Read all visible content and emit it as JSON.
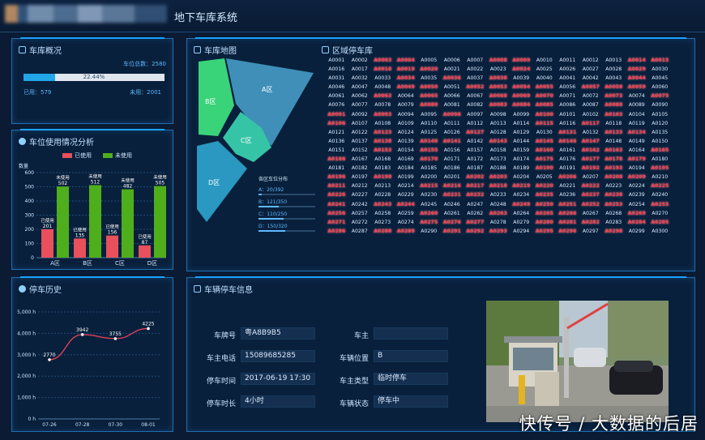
{
  "app": {
    "title": "地下车库系统"
  },
  "overview": {
    "title": "车库概况",
    "total_label": "车位总数：2580",
    "progress": 0.2244,
    "progress_label": "22.44%",
    "used_label": "已用：579",
    "free_label": "未用：2001"
  },
  "usage": {
    "title": "车位使用情况分析",
    "legend_used": "已使用",
    "legend_free": "未使用",
    "colors": {
      "used": "#e8505b",
      "free": "#4fae1c"
    }
  },
  "chart_data": [
    {
      "type": "bar",
      "ylabel": "数量",
      "ylim": [
        0,
        600
      ],
      "yticks": [
        "0",
        "100",
        "200",
        "300",
        "400",
        "500",
        "600"
      ],
      "categories": [
        "A区",
        "B区",
        "C区",
        "D区"
      ],
      "series": [
        {
          "name": "已使用",
          "values": [
            201,
            135,
            156,
            87
          ],
          "labels": [
            "已使用",
            "已使用",
            "已使用",
            "已使用"
          ]
        },
        {
          "name": "未使用",
          "values": [
            502,
            512,
            482,
            505
          ],
          "labels": [
            "未使用",
            "未使用",
            "未使用",
            "未使用"
          ]
        }
      ]
    },
    {
      "type": "line",
      "x": [
        "07-26",
        "07-28",
        "07-30",
        "08-01"
      ],
      "values": [
        2770,
        3942,
        3755,
        4225
      ],
      "ylim": [
        0,
        5000
      ],
      "yticks": [
        "0 h",
        "1,000 h",
        "2,000 h",
        "3,000 h",
        "4,000 h",
        "5,000 h"
      ]
    }
  ],
  "map": {
    "title": "车库地图",
    "zones": {
      "a": "A区",
      "b": "B区",
      "c": "C区",
      "d": "D区"
    },
    "legend_title": "各区车位分布",
    "legend": [
      {
        "label": "A：20/392",
        "ratio": 0.05
      },
      {
        "label": "B：121/350",
        "ratio": 0.35
      },
      {
        "label": "C：110/250",
        "ratio": 0.44
      },
      {
        "label": "D：150/320",
        "ratio": 0.47
      }
    ]
  },
  "slots_title": "区域停车库",
  "slots": [
    [
      "A0001",
      "A0002",
      "A0003",
      "A0004",
      "A0005",
      "A0006",
      "A0007",
      "A0008",
      "A0009",
      "A0010",
      "A0011",
      "A0012",
      "A0013",
      "A0014",
      "A0015"
    ],
    [
      "A0016",
      "A0017",
      "A0018",
      "A0019",
      "A0020",
      "A0021",
      "A0022",
      "A0023",
      "A0024",
      "A0025",
      "A0026",
      "A0027",
      "A0028",
      "A0029",
      "A0030"
    ],
    [
      "A0031",
      "A0032",
      "A0033",
      "A0034",
      "A0035",
      "A0036",
      "A0037",
      "A0038",
      "A0039",
      "A0040",
      "A0041",
      "A0042",
      "A0043",
      "A0044",
      "A0045"
    ],
    [
      "A0046",
      "A0047",
      "A0048",
      "A0049",
      "A0050",
      "A0051",
      "A0052",
      "A0053",
      "A0054",
      "A0055",
      "A0056",
      "A0057",
      "A0058",
      "A0059",
      "A0060"
    ],
    [
      "A0061",
      "A0062",
      "A0063",
      "A0064",
      "A0065",
      "A0066",
      "A0067",
      "A0068",
      "A0069",
      "A0070",
      "A0071",
      "A0072",
      "A0073",
      "A0074",
      "A0075"
    ],
    [
      "A0076",
      "A0077",
      "A0078",
      "A0079",
      "A0080",
      "A0081",
      "A0082",
      "A0083",
      "A0084",
      "A0085",
      "A0086",
      "A0087",
      "A0088",
      "A0089",
      "A0090"
    ],
    [
      "A0091",
      "A0092",
      "A0093",
      "A0094",
      "A0095",
      "A0096",
      "A0097",
      "A0098",
      "A0099",
      "A0100",
      "A0101",
      "A0102",
      "A0103",
      "A0104",
      "A0105"
    ],
    [
      "A0106",
      "A0107",
      "A0108",
      "A0109",
      "A0110",
      "A0111",
      "A0112",
      "A0113",
      "A0114",
      "A0115",
      "A0116",
      "A0117",
      "A0118",
      "A0119",
      "A0120"
    ],
    [
      "A0121",
      "A0122",
      "A0123",
      "A0124",
      "A0125",
      "A0126",
      "A0127",
      "A0128",
      "A0129",
      "A0130",
      "A0131",
      "A0132",
      "A0133",
      "A0134",
      "A0135"
    ],
    [
      "A0136",
      "A0137",
      "A0138",
      "A0139",
      "A0140",
      "A0141",
      "A0142",
      "A0143",
      "A0144",
      "A0145",
      "A0146",
      "A0147",
      "A0148",
      "A0149",
      "A0150"
    ],
    [
      "A0151",
      "A0152",
      "A0153",
      "A0154",
      "A0155",
      "A0156",
      "A0157",
      "A0158",
      "A0159",
      "A0160",
      "A0161",
      "A0162",
      "A0163",
      "A0164",
      "A0165"
    ],
    [
      "A0166",
      "A0167",
      "A0168",
      "A0169",
      "A0170",
      "A0171",
      "A0172",
      "A0173",
      "A0174",
      "A0175",
      "A0176",
      "A0177",
      "A0178",
      "A0179",
      "A0180"
    ],
    [
      "A0181",
      "A0182",
      "A0183",
      "A0184",
      "A0185",
      "A0186",
      "A0187",
      "A0188",
      "A0189",
      "A0190",
      "A0191",
      "A0192",
      "A0193",
      "A0194",
      "A0195"
    ],
    [
      "A0196",
      "A0197",
      "A0198",
      "A0199",
      "A0200",
      "A0201",
      "A0202",
      "A0203",
      "A0204",
      "A0205",
      "A0206",
      "A0207",
      "A0208",
      "A0209",
      "A0210"
    ],
    [
      "A0211",
      "A0212",
      "A0213",
      "A0214",
      "A0215",
      "A0216",
      "A0217",
      "A0218",
      "A0219",
      "A0220",
      "A0221",
      "A0222",
      "A0223",
      "A0224",
      "A0225"
    ],
    [
      "A0226",
      "A0227",
      "A0228",
      "A0229",
      "A0230",
      "A0231",
      "A0232",
      "A0233",
      "A0234",
      "A0235",
      "A0236",
      "A0237",
      "A0238",
      "A0239",
      "A0240"
    ],
    [
      "A0241",
      "A0242",
      "A0243",
      "A0244",
      "A0245",
      "A0246",
      "A0247",
      "A0248",
      "A0249",
      "A0250",
      "A0251",
      "A0252",
      "A0253",
      "A0254",
      "A0255"
    ],
    [
      "A0256",
      "A0257",
      "A0258",
      "A0259",
      "A0260",
      "A0261",
      "A0262",
      "A0263",
      "A0264",
      "A0265",
      "A0266",
      "A0267",
      "A0268",
      "A0269",
      "A0270"
    ],
    [
      "A0271",
      "A0272",
      "A0273",
      "A0274",
      "A0275",
      "A0276",
      "A0277",
      "A0278",
      "A0279",
      "A0280",
      "A0281",
      "A0282",
      "A0283",
      "A0284",
      "A0285"
    ],
    [
      "A0286",
      "A0287",
      "A0288",
      "A0289",
      "A0290",
      "A0291",
      "A0292",
      "A0293",
      "A0294",
      "A0295",
      "A0296",
      "A0297",
      "A0298",
      "A0299",
      "A0300"
    ]
  ],
  "occupied": [
    [
      3,
      4,
      8,
      9,
      14,
      15
    ],
    [
      3,
      4,
      5,
      9,
      14
    ],
    [
      4,
      6,
      8,
      14
    ],
    [
      4,
      5,
      7,
      8,
      9,
      10,
      12,
      13,
      14
    ],
    [
      3,
      5,
      8,
      9,
      10,
      13,
      15
    ],
    [
      5,
      8,
      9,
      10,
      13
    ],
    [
      1,
      3,
      6,
      10,
      13
    ],
    [
      1,
      10,
      12
    ],
    [
      3,
      7,
      11,
      13,
      14
    ],
    [
      3,
      5,
      6,
      8,
      10,
      11,
      12
    ],
    [
      3,
      5,
      10,
      12,
      13,
      15
    ],
    [
      1,
      5,
      10,
      12,
      13,
      14
    ],
    [
      10,
      12,
      13,
      15
    ],
    [
      1,
      3,
      7,
      8,
      11,
      13,
      14
    ],
    [
      1,
      5,
      6,
      7,
      8,
      9,
      10,
      12,
      15
    ],
    [
      1,
      6,
      7,
      10,
      12,
      13
    ],
    [
      1,
      3,
      4,
      9,
      10,
      11,
      12,
      13,
      15
    ],
    [
      1,
      5,
      8,
      10,
      11,
      14
    ],
    [
      1,
      5,
      6,
      7,
      10,
      11,
      12,
      14,
      15
    ],
    [
      1,
      3,
      4,
      6,
      7,
      8,
      10,
      11,
      13
    ]
  ],
  "history": {
    "title": "停车历史"
  },
  "parking_info": {
    "title": "车辆停车信息",
    "fields": {
      "plate_label": "车牌号",
      "plate": "粤A8B9B5",
      "owner_label": "车主",
      "owner": "",
      "phone_label": "车主电话",
      "phone": "15089685285",
      "location_label": "车辆位置",
      "location": "B",
      "time_label": "停车时间",
      "time": "2017-06-19 17:30",
      "type_label": "车主类型",
      "type": "临时停车",
      "duration_label": "停车时长",
      "duration": "4小时",
      "status_label": "车辆状态",
      "status": "停车中"
    }
  },
  "watermark": "快传号 / 大数据的后居"
}
